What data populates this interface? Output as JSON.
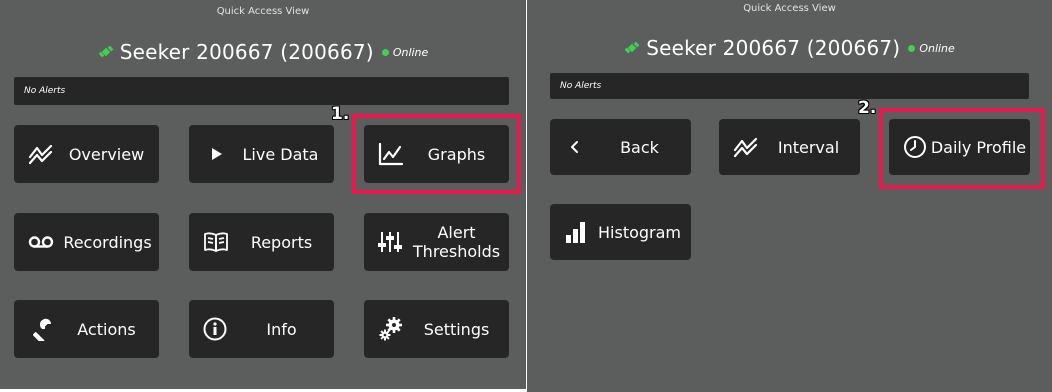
{
  "left_panel": {
    "view_title": "Quick Access View",
    "device": {
      "name": "Seeker 200667 (200667)",
      "status": "Online",
      "status_color": "#40d150"
    },
    "alerts_text": "No Alerts",
    "step_marker": "1.",
    "tiles": {
      "overview": "Overview",
      "live_data": "Live Data",
      "graphs": "Graphs",
      "recordings": "Recordings",
      "reports": "Reports",
      "alert_thresholds_1": "Alert",
      "alert_thresholds_2": "Thresholds",
      "actions": "Actions",
      "info": "Info",
      "settings": "Settings"
    }
  },
  "right_panel": {
    "view_title": "Quick Access View",
    "device": {
      "name": "Seeker 200667 (200667)",
      "status": "Online",
      "status_color": "#40d150"
    },
    "alerts_text": "No Alerts",
    "step_marker": "2.",
    "tiles": {
      "back": "Back",
      "interval": "Interval",
      "daily_profile": "Daily Profile",
      "histogram": "Histogram"
    }
  },
  "colors": {
    "panel_bg": "#5b5e5d",
    "tile_bg": "#262626",
    "highlight": "#e8194f",
    "icon_green": "#40d150"
  },
  "icons": [
    "satellite-icon",
    "trend-icon",
    "play-icon",
    "graph-icon",
    "voicemail-icon",
    "book-icon",
    "sliders-icon",
    "wrench-icon",
    "info-icon",
    "gears-icon",
    "chevron-left-icon",
    "clock-icon",
    "bar-chart-icon"
  ]
}
